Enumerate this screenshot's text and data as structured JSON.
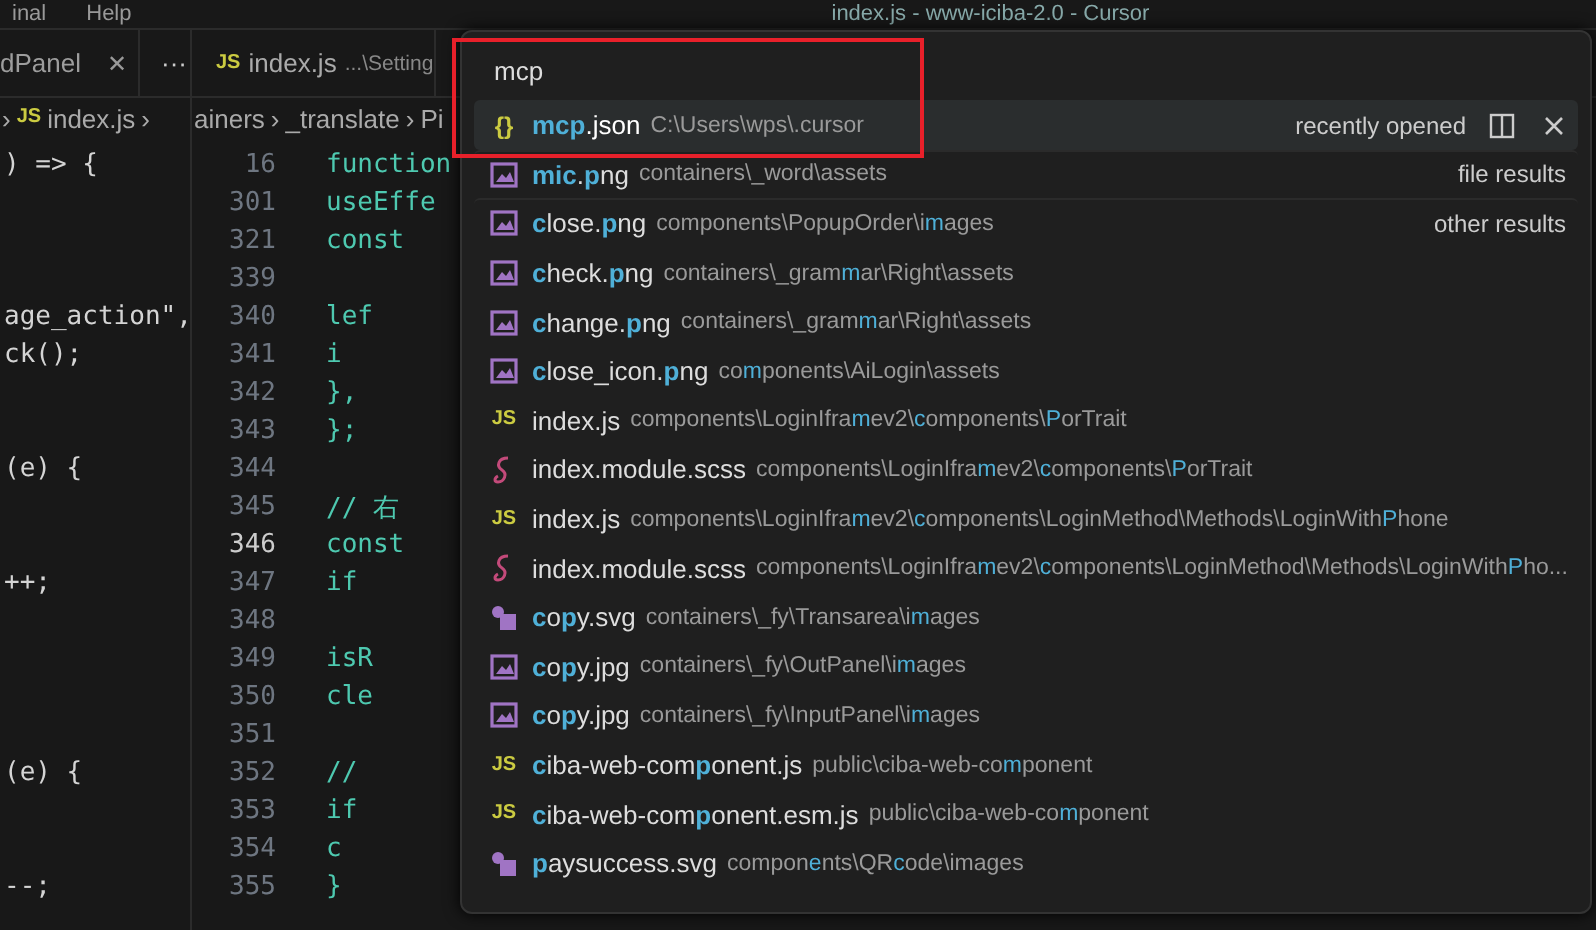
{
  "title_bar": {
    "menu": [
      "inal",
      "Help"
    ],
    "title": "index.js - www-iciba-2.0 - Cursor"
  },
  "tabs": [
    {
      "label": "dPanel",
      "close": "✕",
      "selected": false
    },
    {
      "label": "index.js",
      "icon": "JS",
      "path": "...\\Setting",
      "selected": true
    }
  ],
  "more_tabs": "···",
  "breadcrumb": [
    {
      "kind": "separator",
      "text": "›"
    },
    {
      "kind": "item",
      "icon": "JS",
      "text": "index.js"
    },
    {
      "kind": "separator",
      "text": "›"
    },
    {
      "kind": "item",
      "text": "ainers"
    },
    {
      "kind": "separator",
      "text": "›"
    },
    {
      "kind": "item",
      "text": "_translate"
    },
    {
      "kind": "separator",
      "text": "›"
    },
    {
      "kind": "item",
      "text": "Pi"
    }
  ],
  "editor_lines": [
    {
      "number": "16",
      "left": ") => {",
      "code": "function",
      "current": false
    },
    {
      "number": "301",
      "code": "useEffe",
      "current": false
    },
    {
      "number": "321",
      "code": "const",
      "current": false
    },
    {
      "number": "339",
      "current": false
    },
    {
      "number": "340",
      "left": "age_action\",",
      "code": "lef",
      "current": false
    },
    {
      "number": "341",
      "left": "ck();",
      "code": "i",
      "current": false
    },
    {
      "number": "342",
      "code": "},",
      "current": false
    },
    {
      "number": "343",
      "code": "};",
      "current": false
    },
    {
      "number": "344",
      "left": "(e) {",
      "current": false
    },
    {
      "number": "345",
      "code": "// 右",
      "current": false
    },
    {
      "number": "346",
      "code": "const",
      "current": true
    },
    {
      "number": "347",
      "left": "++;",
      "code": "if",
      "current": false
    },
    {
      "number": "348",
      "current": false
    },
    {
      "number": "349",
      "code": "isR",
      "current": false
    },
    {
      "number": "350",
      "code": "cle",
      "current": false
    },
    {
      "number": "351",
      "current": false
    },
    {
      "number": "352",
      "left": "(e) {",
      "code": "//",
      "current": false
    },
    {
      "number": "353",
      "code": "if",
      "current": false
    },
    {
      "number": "354",
      "code": "c",
      "current": false
    },
    {
      "number": "355",
      "left": "--;",
      "code": "}",
      "current": false
    }
  ],
  "quick_open": {
    "query": "mcp",
    "results": [
      {
        "kind": "json",
        "icon": "{}",
        "name": "**mcp**.json",
        "path": "C:\\Users\\wps\\.cursor",
        "label": "recently opened",
        "selected": true
      },
      {
        "kind": "image",
        "name": "**mic**.**p**ng",
        "path": "containers\\_word\\assets",
        "label": "file results",
        "selected": false
      },
      {
        "kind": "image",
        "name": "**c**lose.**p**ng",
        "path": "components\\PopupOrder\\i**m**ages",
        "label": "other results",
        "selected": false
      },
      {
        "kind": "image",
        "name": "**c**heck.**p**ng",
        "path": "containers\\_gram**m**ar\\Right\\assets",
        "selected": false
      },
      {
        "kind": "image",
        "name": "**c**hange.**p**ng",
        "path": "containers\\_gram**m**ar\\Right\\assets",
        "selected": false
      },
      {
        "kind": "image",
        "name": "**c**lose_icon.**p**ng",
        "path": "co**m**ponents\\AiLogin\\assets",
        "selected": false
      },
      {
        "kind": "js",
        "icon": "JS",
        "name": "index.js",
        "path": "components\\LoginIfra**m**ev2\\**c**omponents\\**P**orTrait",
        "selected": false
      },
      {
        "kind": "scss",
        "name": "index.module.scss",
        "path": "components\\LoginIfra**m**ev2\\**c**omponents\\**P**orTrait",
        "selected": false
      },
      {
        "kind": "js",
        "icon": "JS",
        "name": "index.js",
        "path": "components\\LoginIfra**m**ev2\\**c**omponents\\LoginMethod\\Methods\\LoginWith**P**hone",
        "selected": false
      },
      {
        "kind": "scss",
        "name": "index.module.scss",
        "path": "components\\LoginIfra**m**ev2\\**c**omponents\\LoginMethod\\Methods\\LoginWith**P**ho...",
        "selected": false
      },
      {
        "kind": "svg",
        "name": "**c**o**p**y.svg",
        "path": "containers\\_fy\\Transarea\\i**m**ages",
        "selected": false
      },
      {
        "kind": "image",
        "name": "**c**o**p**y.jpg",
        "path": "containers\\_fy\\OutPanel\\i**m**ages",
        "selected": false
      },
      {
        "kind": "image",
        "name": "**c**o**p**y.jpg",
        "path": "containers\\_fy\\InputPanel\\i**m**ages",
        "selected": false
      },
      {
        "kind": "js",
        "icon": "JS",
        "name": "**c**iba-web-com**p**onent.js",
        "path": "public\\ciba-web-co**m**ponent",
        "selected": false
      },
      {
        "kind": "js",
        "icon": "JS",
        "name": "**c**iba-web-com**p**onent.esm.js",
        "path": "public\\ciba-web-co**m**ponent",
        "selected": false
      },
      {
        "kind": "svg",
        "name": "**p**aysuccess.svg",
        "path": "compon**e**nts\\QR**c**ode\\images",
        "selected": false
      }
    ]
  }
}
